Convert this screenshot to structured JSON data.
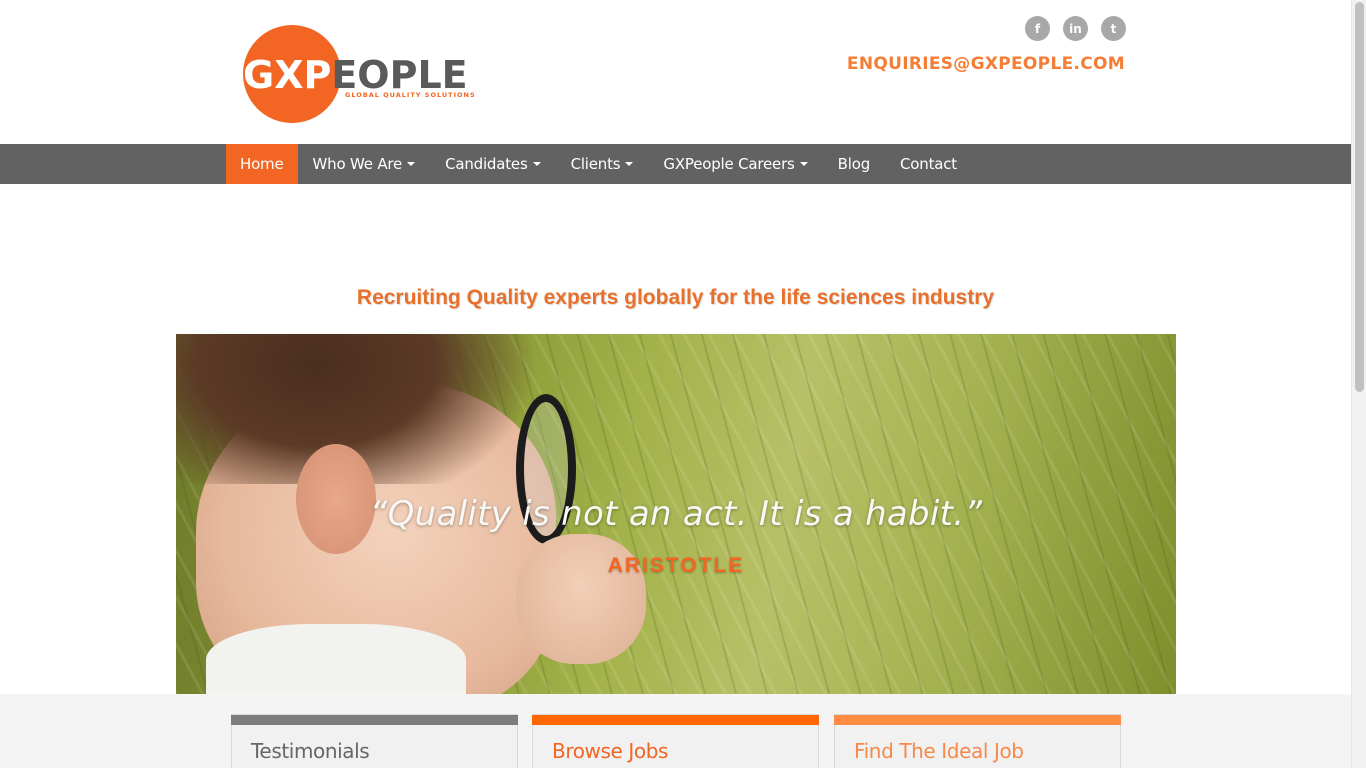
{
  "header": {
    "logo": {
      "gx": "GXP",
      "rest": "EOPLE",
      "tagline": "GLOBAL QUALITY SOLUTIONS"
    },
    "social": [
      {
        "name": "facebook-icon",
        "glyph": "f"
      },
      {
        "name": "linkedin-icon",
        "glyph": "in"
      },
      {
        "name": "twitter-icon",
        "glyph": "t"
      }
    ],
    "email": "ENQUIRIES@GXPEOPLE.COM"
  },
  "nav": {
    "items": [
      {
        "label": "Home",
        "active": true,
        "dropdown": false
      },
      {
        "label": "Who We Are",
        "active": false,
        "dropdown": true
      },
      {
        "label": "Candidates",
        "active": false,
        "dropdown": true
      },
      {
        "label": "Clients",
        "active": false,
        "dropdown": true
      },
      {
        "label": "GXPeople Careers",
        "active": false,
        "dropdown": true
      },
      {
        "label": "Blog",
        "active": false,
        "dropdown": false
      },
      {
        "label": "Contact",
        "active": false,
        "dropdown": false
      }
    ]
  },
  "tagline": "Recruiting Quality experts globally for the life sciences industry",
  "hero": {
    "quote": "“Quality is not an act. It is a habit.”",
    "author": "ARISTOTLE"
  },
  "cards": [
    {
      "title": "Testimonials",
      "bar_color": "#7d7d7d",
      "title_color": "#666666"
    },
    {
      "title": "Browse Jobs",
      "bar_color": "#ff6600",
      "title_color": "#f26522"
    },
    {
      "title": "Find The Ideal Job",
      "bar_color": "#ff8c42",
      "title_color": "#f58a4b"
    }
  ],
  "colors": {
    "brand_orange": "#f26522",
    "nav_bg": "#626262"
  }
}
